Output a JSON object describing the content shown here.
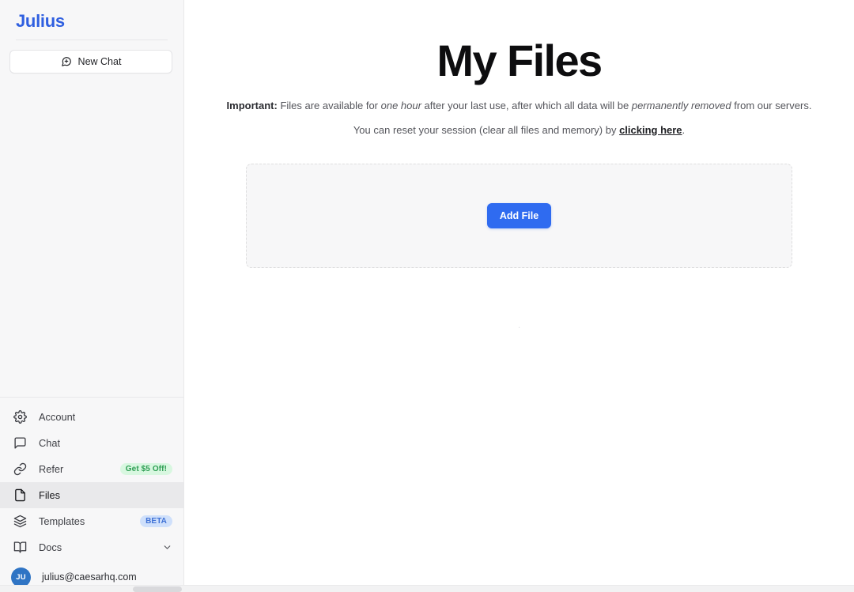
{
  "sidebar": {
    "brand": "Julius",
    "new_chat": {
      "label": "New Chat",
      "icon": "message-square-plus-icon"
    },
    "nav_items": [
      {
        "label": "Account",
        "icon": "gear-icon",
        "badge": null,
        "badge_style": null,
        "active": false,
        "chevron": false
      },
      {
        "label": "Chat",
        "icon": "message-square-icon",
        "badge": null,
        "badge_style": null,
        "active": false,
        "chevron": false
      },
      {
        "label": "Refer",
        "icon": "link-icon",
        "badge": "Get $5 Off!",
        "badge_style": "green",
        "active": false,
        "chevron": false
      },
      {
        "label": "Files",
        "icon": "file-icon",
        "badge": null,
        "badge_style": null,
        "active": true,
        "chevron": false
      },
      {
        "label": "Templates",
        "icon": "layers-icon",
        "badge": "BETA",
        "badge_style": "blue",
        "active": false,
        "chevron": false
      },
      {
        "label": "Docs",
        "icon": "book-open-icon",
        "badge": null,
        "badge_style": null,
        "active": false,
        "chevron": true
      }
    ],
    "user": {
      "initials": "JU",
      "email": "julius@caesarhq.com"
    }
  },
  "main": {
    "title": "My Files",
    "notice": {
      "label": "Important:",
      "part1": " Files are available for ",
      "em1": "one hour",
      "part2": " after your last use, after which all data will be ",
      "em2": "permanently removed",
      "part3": " from our servers."
    },
    "reset_notice": {
      "prefix": "You can reset your session (clear all files and memory) by ",
      "link": "clicking here",
      "suffix": "."
    },
    "dropzone": {
      "add_file_label": "Add File"
    },
    "footer_dot": "."
  },
  "colors": {
    "brand_blue": "#2f5fe0",
    "accent_blue": "#2f6bf0",
    "badge_green_bg": "#d8f7e0",
    "badge_green_fg": "#2f9e54",
    "badge_blue_bg": "#cfe0fb",
    "badge_blue_fg": "#4072d6",
    "sidebar_bg": "#f7f7f8",
    "active_row_bg": "#e9e9eb",
    "avatar_bg": "#2f74c4"
  }
}
